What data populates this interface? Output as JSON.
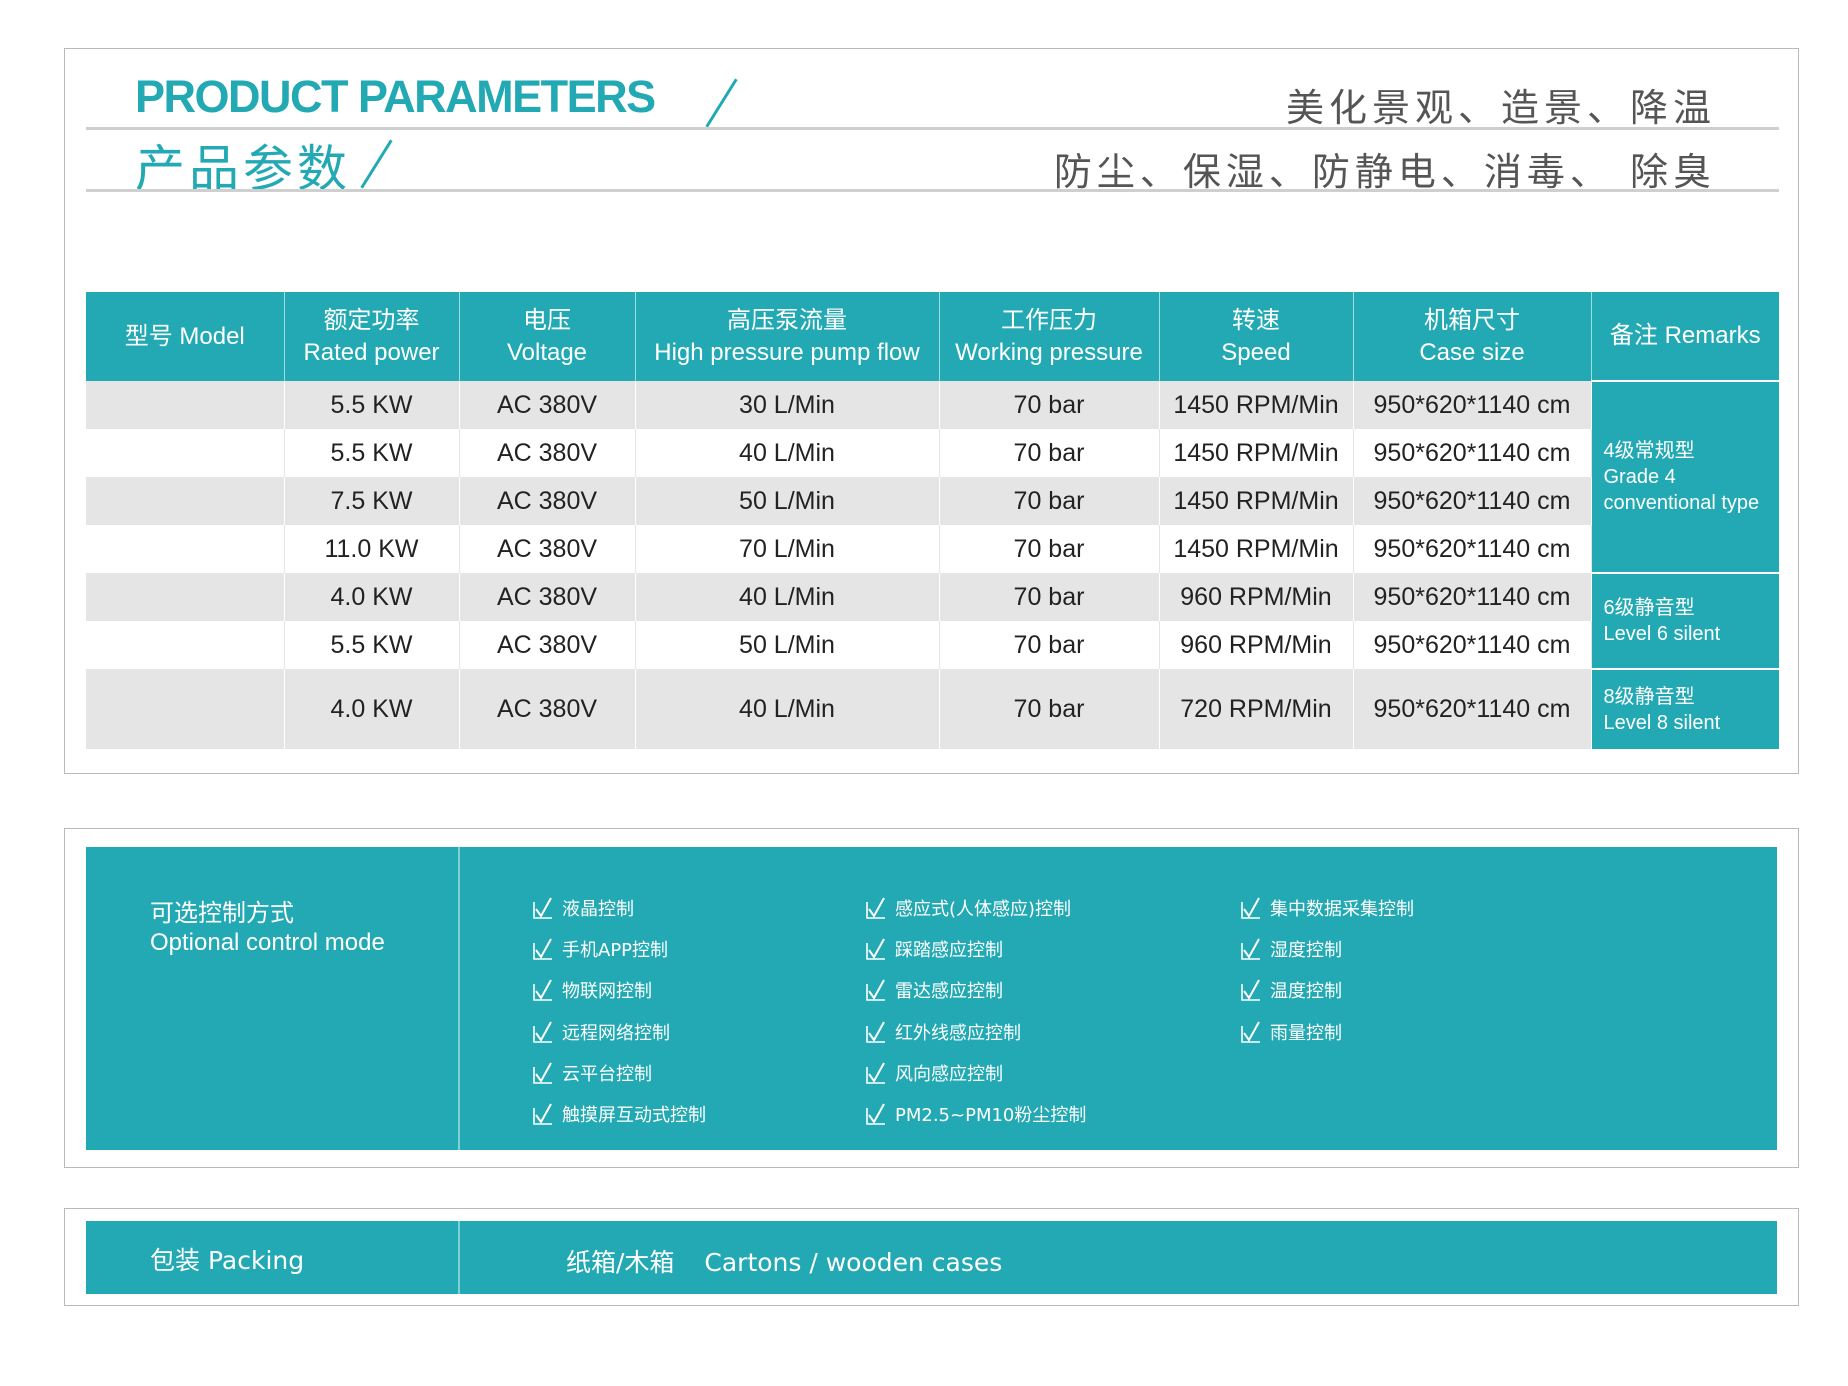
{
  "header": {
    "title_en": "PRODUCT PARAMETERS",
    "title_cn": "产品参数",
    "tagline_1": "美化景观、造景、降温",
    "tagline_2": "防尘、保湿、防静电、消毒、 除臭"
  },
  "table": {
    "columns": [
      {
        "cn": "型号 Model",
        "en": ""
      },
      {
        "cn": "额定功率",
        "en": "Rated power"
      },
      {
        "cn": "电压",
        "en": "Voltage"
      },
      {
        "cn": "高压泵流量",
        "en": "High pressure pump flow"
      },
      {
        "cn": "工作压力",
        "en": "Working pressure"
      },
      {
        "cn": "转速",
        "en": "Speed"
      },
      {
        "cn": "机箱尺寸",
        "en": "Case size"
      },
      {
        "cn": "备注 Remarks",
        "en": ""
      }
    ],
    "rows": [
      {
        "model": "",
        "power": "5.5 KW",
        "voltage": "AC 380V",
        "flow": "30 L/Min",
        "pressure": "70 bar",
        "speed": "1450 RPM/Min",
        "size": "950*620*1140 cm"
      },
      {
        "model": "",
        "power": "5.5 KW",
        "voltage": "AC 380V",
        "flow": "40 L/Min",
        "pressure": "70 bar",
        "speed": "1450 RPM/Min",
        "size": "950*620*1140 cm"
      },
      {
        "model": "",
        "power": "7.5 KW",
        "voltage": "AC 380V",
        "flow": "50 L/Min",
        "pressure": "70 bar",
        "speed": "1450 RPM/Min",
        "size": "950*620*1140 cm"
      },
      {
        "model": "",
        "power": "11.0 KW",
        "voltage": "AC 380V",
        "flow": "70 L/Min",
        "pressure": "70 bar",
        "speed": "1450 RPM/Min",
        "size": "950*620*1140 cm"
      },
      {
        "model": "",
        "power": "4.0 KW",
        "voltage": "AC 380V",
        "flow": "40 L/Min",
        "pressure": "70 bar",
        "speed": "960 RPM/Min",
        "size": "950*620*1140 cm"
      },
      {
        "model": "",
        "power": "5.5 KW",
        "voltage": "AC 380V",
        "flow": "50 L/Min",
        "pressure": "70 bar",
        "speed": "960 RPM/Min",
        "size": "950*620*1140 cm"
      },
      {
        "model": "",
        "power": "4.0 KW",
        "voltage": "AC 380V",
        "flow": "40 L/Min",
        "pressure": "70 bar",
        "speed": "720 RPM/Min",
        "size": "950*620*1140 cm"
      }
    ],
    "remarks": [
      {
        "cn": "4级常规型",
        "en": "Grade 4 conventional type"
      },
      {
        "cn": "6级静音型",
        "en": "Level 6 silent"
      },
      {
        "cn": "8级静音型",
        "en": "Level 8 silent"
      }
    ]
  },
  "control": {
    "label_cn": "可选控制方式",
    "label_en": "Optional control mode",
    "col1": [
      "液晶控制",
      "手机APP控制",
      "物联网控制",
      "远程网络控制",
      "云平台控制",
      "触摸屏互动式控制"
    ],
    "col2": [
      "感应式(人体感应)控制",
      "踩踏感应控制",
      "雷达感应控制",
      "红外线感应控制",
      "风向感应控制",
      "PM2.5~PM10粉尘控制"
    ],
    "col3": [
      "集中数据采集控制",
      "湿度控制",
      "温度控制",
      "雨量控制"
    ]
  },
  "packing": {
    "label": "包装 Packing",
    "value_cn": "纸箱/木箱",
    "value_en": "Cartons / wooden cases"
  },
  "colors": {
    "accent": "#22a9b3",
    "row_shade": "#e5e5e5",
    "border": "#b9b9b9"
  }
}
